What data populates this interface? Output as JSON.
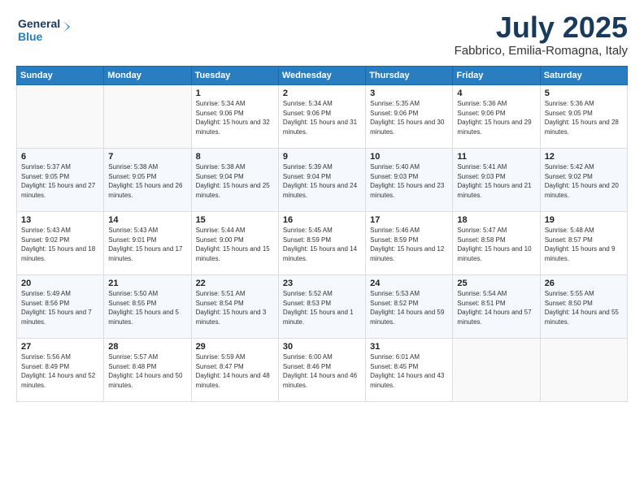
{
  "header": {
    "logo_line1": "General",
    "logo_line2": "Blue",
    "month": "July 2025",
    "location": "Fabbrico, Emilia-Romagna, Italy"
  },
  "weekdays": [
    "Sunday",
    "Monday",
    "Tuesday",
    "Wednesday",
    "Thursday",
    "Friday",
    "Saturday"
  ],
  "weeks": [
    [
      {
        "day": "",
        "sunrise": "",
        "sunset": "",
        "daylight": ""
      },
      {
        "day": "",
        "sunrise": "",
        "sunset": "",
        "daylight": ""
      },
      {
        "day": "1",
        "sunrise": "Sunrise: 5:34 AM",
        "sunset": "Sunset: 9:06 PM",
        "daylight": "Daylight: 15 hours and 32 minutes."
      },
      {
        "day": "2",
        "sunrise": "Sunrise: 5:34 AM",
        "sunset": "Sunset: 9:06 PM",
        "daylight": "Daylight: 15 hours and 31 minutes."
      },
      {
        "day": "3",
        "sunrise": "Sunrise: 5:35 AM",
        "sunset": "Sunset: 9:06 PM",
        "daylight": "Daylight: 15 hours and 30 minutes."
      },
      {
        "day": "4",
        "sunrise": "Sunrise: 5:36 AM",
        "sunset": "Sunset: 9:06 PM",
        "daylight": "Daylight: 15 hours and 29 minutes."
      },
      {
        "day": "5",
        "sunrise": "Sunrise: 5:36 AM",
        "sunset": "Sunset: 9:05 PM",
        "daylight": "Daylight: 15 hours and 28 minutes."
      }
    ],
    [
      {
        "day": "6",
        "sunrise": "Sunrise: 5:37 AM",
        "sunset": "Sunset: 9:05 PM",
        "daylight": "Daylight: 15 hours and 27 minutes."
      },
      {
        "day": "7",
        "sunrise": "Sunrise: 5:38 AM",
        "sunset": "Sunset: 9:05 PM",
        "daylight": "Daylight: 15 hours and 26 minutes."
      },
      {
        "day": "8",
        "sunrise": "Sunrise: 5:38 AM",
        "sunset": "Sunset: 9:04 PM",
        "daylight": "Daylight: 15 hours and 25 minutes."
      },
      {
        "day": "9",
        "sunrise": "Sunrise: 5:39 AM",
        "sunset": "Sunset: 9:04 PM",
        "daylight": "Daylight: 15 hours and 24 minutes."
      },
      {
        "day": "10",
        "sunrise": "Sunrise: 5:40 AM",
        "sunset": "Sunset: 9:03 PM",
        "daylight": "Daylight: 15 hours and 23 minutes."
      },
      {
        "day": "11",
        "sunrise": "Sunrise: 5:41 AM",
        "sunset": "Sunset: 9:03 PM",
        "daylight": "Daylight: 15 hours and 21 minutes."
      },
      {
        "day": "12",
        "sunrise": "Sunrise: 5:42 AM",
        "sunset": "Sunset: 9:02 PM",
        "daylight": "Daylight: 15 hours and 20 minutes."
      }
    ],
    [
      {
        "day": "13",
        "sunrise": "Sunrise: 5:43 AM",
        "sunset": "Sunset: 9:02 PM",
        "daylight": "Daylight: 15 hours and 18 minutes."
      },
      {
        "day": "14",
        "sunrise": "Sunrise: 5:43 AM",
        "sunset": "Sunset: 9:01 PM",
        "daylight": "Daylight: 15 hours and 17 minutes."
      },
      {
        "day": "15",
        "sunrise": "Sunrise: 5:44 AM",
        "sunset": "Sunset: 9:00 PM",
        "daylight": "Daylight: 15 hours and 15 minutes."
      },
      {
        "day": "16",
        "sunrise": "Sunrise: 5:45 AM",
        "sunset": "Sunset: 8:59 PM",
        "daylight": "Daylight: 15 hours and 14 minutes."
      },
      {
        "day": "17",
        "sunrise": "Sunrise: 5:46 AM",
        "sunset": "Sunset: 8:59 PM",
        "daylight": "Daylight: 15 hours and 12 minutes."
      },
      {
        "day": "18",
        "sunrise": "Sunrise: 5:47 AM",
        "sunset": "Sunset: 8:58 PM",
        "daylight": "Daylight: 15 hours and 10 minutes."
      },
      {
        "day": "19",
        "sunrise": "Sunrise: 5:48 AM",
        "sunset": "Sunset: 8:57 PM",
        "daylight": "Daylight: 15 hours and 9 minutes."
      }
    ],
    [
      {
        "day": "20",
        "sunrise": "Sunrise: 5:49 AM",
        "sunset": "Sunset: 8:56 PM",
        "daylight": "Daylight: 15 hours and 7 minutes."
      },
      {
        "day": "21",
        "sunrise": "Sunrise: 5:50 AM",
        "sunset": "Sunset: 8:55 PM",
        "daylight": "Daylight: 15 hours and 5 minutes."
      },
      {
        "day": "22",
        "sunrise": "Sunrise: 5:51 AM",
        "sunset": "Sunset: 8:54 PM",
        "daylight": "Daylight: 15 hours and 3 minutes."
      },
      {
        "day": "23",
        "sunrise": "Sunrise: 5:52 AM",
        "sunset": "Sunset: 8:53 PM",
        "daylight": "Daylight: 15 hours and 1 minute."
      },
      {
        "day": "24",
        "sunrise": "Sunrise: 5:53 AM",
        "sunset": "Sunset: 8:52 PM",
        "daylight": "Daylight: 14 hours and 59 minutes."
      },
      {
        "day": "25",
        "sunrise": "Sunrise: 5:54 AM",
        "sunset": "Sunset: 8:51 PM",
        "daylight": "Daylight: 14 hours and 57 minutes."
      },
      {
        "day": "26",
        "sunrise": "Sunrise: 5:55 AM",
        "sunset": "Sunset: 8:50 PM",
        "daylight": "Daylight: 14 hours and 55 minutes."
      }
    ],
    [
      {
        "day": "27",
        "sunrise": "Sunrise: 5:56 AM",
        "sunset": "Sunset: 8:49 PM",
        "daylight": "Daylight: 14 hours and 52 minutes."
      },
      {
        "day": "28",
        "sunrise": "Sunrise: 5:57 AM",
        "sunset": "Sunset: 8:48 PM",
        "daylight": "Daylight: 14 hours and 50 minutes."
      },
      {
        "day": "29",
        "sunrise": "Sunrise: 5:59 AM",
        "sunset": "Sunset: 8:47 PM",
        "daylight": "Daylight: 14 hours and 48 minutes."
      },
      {
        "day": "30",
        "sunrise": "Sunrise: 6:00 AM",
        "sunset": "Sunset: 8:46 PM",
        "daylight": "Daylight: 14 hours and 46 minutes."
      },
      {
        "day": "31",
        "sunrise": "Sunrise: 6:01 AM",
        "sunset": "Sunset: 8:45 PM",
        "daylight": "Daylight: 14 hours and 43 minutes."
      },
      {
        "day": "",
        "sunrise": "",
        "sunset": "",
        "daylight": ""
      },
      {
        "day": "",
        "sunrise": "",
        "sunset": "",
        "daylight": ""
      }
    ]
  ]
}
